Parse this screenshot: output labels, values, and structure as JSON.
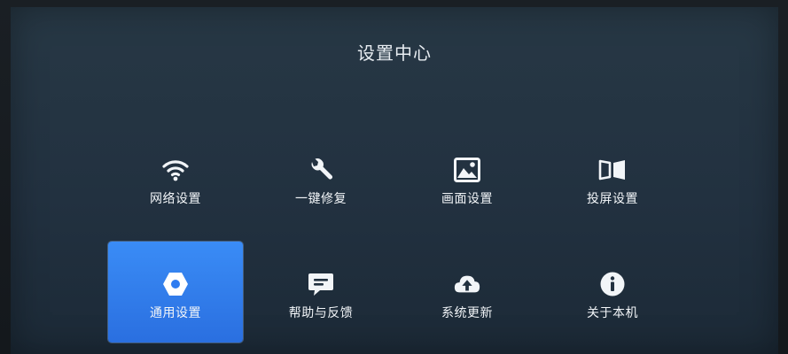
{
  "page": {
    "title": "设置中心",
    "colors": {
      "background": "#223140",
      "selected_tile": "#2f7cf0",
      "text": "#f2f5f8"
    }
  },
  "menu": {
    "items": [
      {
        "label": "网络设置",
        "icon": "wifi-icon",
        "selected": false
      },
      {
        "label": "一键修复",
        "icon": "wrench-icon",
        "selected": false
      },
      {
        "label": "画面设置",
        "icon": "image-icon",
        "selected": false
      },
      {
        "label": "投屏设置",
        "icon": "screen-cast-icon",
        "selected": false
      },
      {
        "label": "通用设置",
        "icon": "hexagon-settings-icon",
        "selected": true
      },
      {
        "label": "帮助与反馈",
        "icon": "chat-feedback-icon",
        "selected": false
      },
      {
        "label": "系统更新",
        "icon": "cloud-upload-icon",
        "selected": false
      },
      {
        "label": "关于本机",
        "icon": "info-icon",
        "selected": false
      }
    ]
  }
}
